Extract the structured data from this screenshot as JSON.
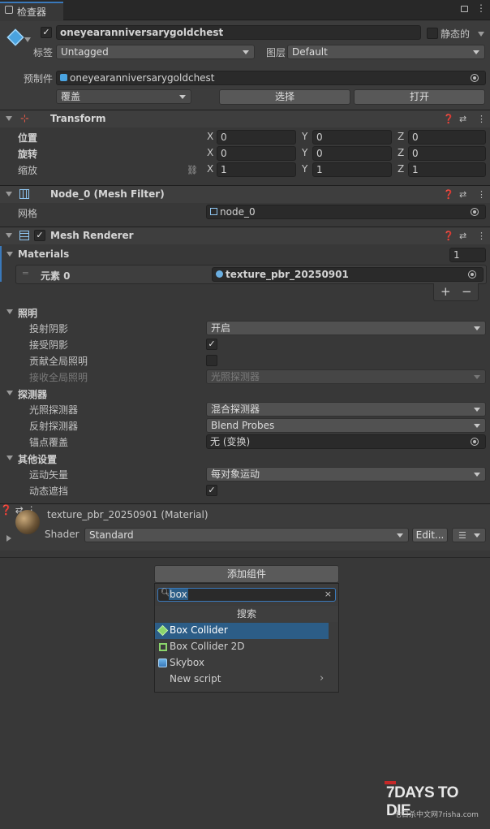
{
  "tab": {
    "title": "检查器"
  },
  "object": {
    "name": "oneyearanniversarygoldchest",
    "static_label": "静态的",
    "tag_label": "标签",
    "tag_value": "Untagged",
    "layer_label": "图层",
    "layer_value": "Default",
    "prefab_label": "预制件",
    "prefab_value": "oneyearanniversarygoldchest",
    "override_label": "覆盖",
    "select_label": "选择",
    "open_label": "打开"
  },
  "transform": {
    "title": "Transform",
    "position_label": "位置",
    "rotation_label": "旋转",
    "scale_label": "缩放",
    "position": [
      "0",
      "0",
      "0"
    ],
    "rotation": [
      "0",
      "0",
      "0"
    ],
    "scale": [
      "1",
      "1",
      "1"
    ],
    "axis": [
      "X",
      "Y",
      "Z"
    ]
  },
  "mesh_filter": {
    "title": "Node_0 (Mesh Filter)",
    "mesh_label": "网格",
    "mesh_value": "node_0"
  },
  "mesh_renderer": {
    "title": "Mesh Renderer",
    "materials_label": "Materials",
    "materials_count": "1",
    "element_label": "元素 0",
    "element_value": "texture_pbr_20250901",
    "plus": "+",
    "minus": "−",
    "lighting_label": "照明",
    "cast_shadows_label": "投射阴影",
    "cast_shadows_value": "开启",
    "receive_shadows_label": "接受阴影",
    "contribute_gi_label": "贡献全局照明",
    "receive_gi_label": "接收全局照明",
    "receive_gi_value": "光照探测器",
    "probes_label": "探测器",
    "light_probes_label": "光照探测器",
    "light_probes_value": "混合探测器",
    "reflection_probes_label": "反射探测器",
    "reflection_probes_value": "Blend Probes",
    "anchor_label": "锚点覆盖",
    "anchor_value": "无 (变换)",
    "other_label": "其他设置",
    "motion_label": "运动矢量",
    "motion_value": "每对象运动",
    "dynamic_occlusion_label": "动态遮挡"
  },
  "material": {
    "title": "texture_pbr_20250901 (Material)",
    "shader_label": "Shader",
    "shader_value": "Standard",
    "edit_label": "Edit..."
  },
  "add_component": {
    "button_label": "添加组件",
    "search_value": "box",
    "search_header": "搜索",
    "results": [
      {
        "label": "Box Collider",
        "icon": "box-collider-icon"
      },
      {
        "label": "Box Collider 2D",
        "icon": "box-collider-2d-icon"
      },
      {
        "label": "Skybox",
        "icon": "skybox-icon"
      },
      {
        "label": "New script",
        "icon": ""
      }
    ]
  },
  "watermark": {
    "line1": "7DAYS TO DIE",
    "line2": "七日杀中文网7risha.com"
  },
  "colors": {
    "panel": "#383838",
    "field": "#2a2a2a",
    "highlight": "#2c5d87",
    "accent": "#c62828"
  }
}
